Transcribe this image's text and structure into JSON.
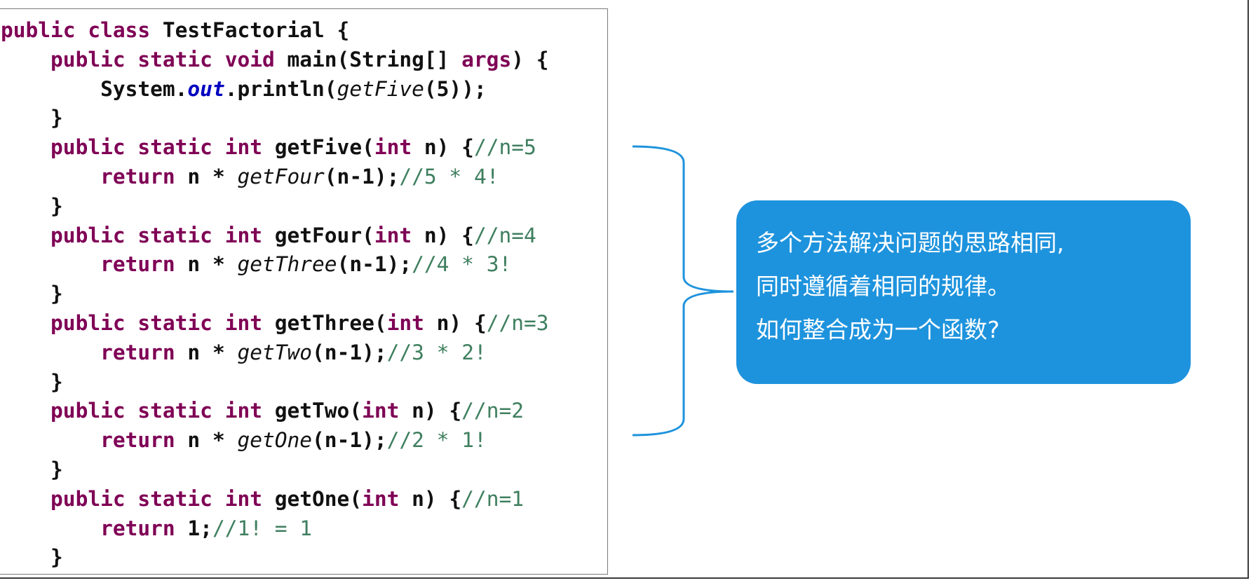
{
  "code": {
    "lines": [
      [
        {
          "t": "kw",
          "v": "public class "
        },
        {
          "t": "plain",
          "v": "TestFactorial {"
        }
      ],
      [
        {
          "t": "plain",
          "v": "    "
        },
        {
          "t": "kw",
          "v": "public static void "
        },
        {
          "t": "plain",
          "v": "main(String[] "
        },
        {
          "t": "kw",
          "v": "args"
        },
        {
          "t": "plain",
          "v": ") {"
        }
      ],
      [
        {
          "t": "plain",
          "v": "        System."
        },
        {
          "t": "field",
          "v": "out"
        },
        {
          "t": "plain",
          "v": ".println("
        },
        {
          "t": "it",
          "v": "getFive"
        },
        {
          "t": "plain",
          "v": "(5));"
        }
      ],
      [
        {
          "t": "plain",
          "v": "    }"
        }
      ],
      [
        {
          "t": "plain",
          "v": "    "
        },
        {
          "t": "kw",
          "v": "public static int "
        },
        {
          "t": "plain",
          "v": "getFive("
        },
        {
          "t": "kw",
          "v": "int "
        },
        {
          "t": "plain",
          "v": "n) {"
        },
        {
          "t": "cm",
          "v": "//n=5"
        }
      ],
      [
        {
          "t": "plain",
          "v": "        "
        },
        {
          "t": "kw",
          "v": "return "
        },
        {
          "t": "plain",
          "v": "n * "
        },
        {
          "t": "it",
          "v": "getFour"
        },
        {
          "t": "plain",
          "v": "(n-1);"
        },
        {
          "t": "cm",
          "v": "//5 * 4!"
        }
      ],
      [
        {
          "t": "plain",
          "v": "    }"
        }
      ],
      [
        {
          "t": "plain",
          "v": "    "
        },
        {
          "t": "kw",
          "v": "public static int "
        },
        {
          "t": "plain",
          "v": "getFour("
        },
        {
          "t": "kw",
          "v": "int "
        },
        {
          "t": "plain",
          "v": "n) {"
        },
        {
          "t": "cm",
          "v": "//n=4"
        }
      ],
      [
        {
          "t": "plain",
          "v": "        "
        },
        {
          "t": "kw",
          "v": "return "
        },
        {
          "t": "plain",
          "v": "n * "
        },
        {
          "t": "it",
          "v": "getThree"
        },
        {
          "t": "plain",
          "v": "(n-1);"
        },
        {
          "t": "cm",
          "v": "//4 * 3!"
        }
      ],
      [
        {
          "t": "plain",
          "v": "    }"
        }
      ],
      [
        {
          "t": "plain",
          "v": "    "
        },
        {
          "t": "kw",
          "v": "public static int "
        },
        {
          "t": "plain",
          "v": "getThree("
        },
        {
          "t": "kw",
          "v": "int "
        },
        {
          "t": "plain",
          "v": "n) {"
        },
        {
          "t": "cm",
          "v": "//n=3"
        }
      ],
      [
        {
          "t": "plain",
          "v": "        "
        },
        {
          "t": "kw",
          "v": "return "
        },
        {
          "t": "plain",
          "v": "n * "
        },
        {
          "t": "it",
          "v": "getTwo"
        },
        {
          "t": "plain",
          "v": "(n-1);"
        },
        {
          "t": "cm",
          "v": "//3 * 2!"
        }
      ],
      [
        {
          "t": "plain",
          "v": "    }"
        }
      ],
      [
        {
          "t": "plain",
          "v": "    "
        },
        {
          "t": "kw",
          "v": "public static int "
        },
        {
          "t": "plain",
          "v": "getTwo("
        },
        {
          "t": "kw",
          "v": "int "
        },
        {
          "t": "plain",
          "v": "n) {"
        },
        {
          "t": "cm",
          "v": "//n=2"
        }
      ],
      [
        {
          "t": "plain",
          "v": "        "
        },
        {
          "t": "kw",
          "v": "return "
        },
        {
          "t": "plain",
          "v": "n * "
        },
        {
          "t": "it",
          "v": "getOne"
        },
        {
          "t": "plain",
          "v": "(n-1);"
        },
        {
          "t": "cm",
          "v": "//2 * 1!"
        }
      ],
      [
        {
          "t": "plain",
          "v": "    }"
        }
      ],
      [
        {
          "t": "plain",
          "v": "    "
        },
        {
          "t": "kw",
          "v": "public static int "
        },
        {
          "t": "plain",
          "v": "getOne("
        },
        {
          "t": "kw",
          "v": "int "
        },
        {
          "t": "plain",
          "v": "n) {"
        },
        {
          "t": "cm",
          "v": "//n=1"
        }
      ],
      [
        {
          "t": "plain",
          "v": "        "
        },
        {
          "t": "kw",
          "v": "return "
        },
        {
          "t": "plain",
          "v": "1;"
        },
        {
          "t": "cm",
          "v": "//1! = 1"
        }
      ],
      [
        {
          "t": "plain",
          "v": "    }"
        }
      ]
    ]
  },
  "callout": {
    "line1": "多个方法解决问题的思路相同,",
    "line2": "同时遵循着相同的规律。",
    "line3": "如何整合成为一个函数?"
  },
  "colors": {
    "keyword": "#7f0055",
    "comment": "#3f7f5f",
    "field": "#0000c0",
    "callout_bg": "#1e93dd",
    "brace": "#1e93dd"
  }
}
